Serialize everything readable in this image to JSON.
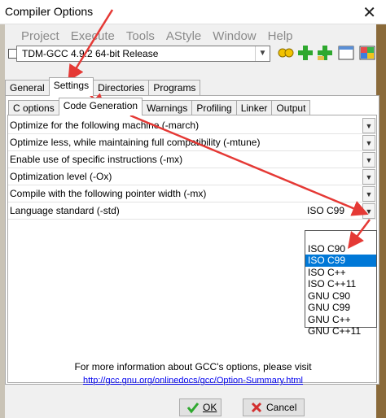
{
  "window": {
    "title": "Compiler Options"
  },
  "background_menu": [
    "Project",
    "Execute",
    "Tools",
    "AStyle",
    "Window",
    "Help"
  ],
  "compiler_set": {
    "value": "TDM-GCC 4.9.2 64-bit Release"
  },
  "main_tabs": [
    {
      "label": "General",
      "active": false
    },
    {
      "label": "Settings",
      "active": true
    },
    {
      "label": "Directories",
      "active": false
    },
    {
      "label": "Programs",
      "active": false
    }
  ],
  "sub_tabs": [
    {
      "label": "C options",
      "active": false
    },
    {
      "label": "Code Generation",
      "active": true
    },
    {
      "label": "Warnings",
      "active": false
    },
    {
      "label": "Profiling",
      "active": false
    },
    {
      "label": "Linker",
      "active": false
    },
    {
      "label": "Output",
      "active": false
    }
  ],
  "options": [
    {
      "label": "Optimize for the following machine (-march)",
      "value": ""
    },
    {
      "label": "Optimize less, while maintaining full compatibility (-mtune)",
      "value": ""
    },
    {
      "label": "Enable use of specific instructions (-mx)",
      "value": ""
    },
    {
      "label": "Optimization level (-Ox)",
      "value": ""
    },
    {
      "label": "Compile with the following pointer width (-mx)",
      "value": ""
    },
    {
      "label": "Language standard (-std)",
      "value": "ISO C99"
    }
  ],
  "dropdown": {
    "items": [
      "",
      "ISO C90",
      "ISO C99",
      "ISO C++",
      "ISO C++11",
      "GNU C90",
      "GNU C99",
      "GNU C++",
      "GNU C++11"
    ],
    "selected": "ISO C99"
  },
  "footer": {
    "info": "For more information about GCC's options, please visit",
    "link": "http://gcc.gnu.org/onlinedocs/gcc/Option-Summary.html"
  },
  "buttons": {
    "ok_label": "OK",
    "cancel_label": "Cancel"
  },
  "colors": {
    "selection": "#0078d7",
    "arrow": "#e53935",
    "link": "#0000ee"
  }
}
